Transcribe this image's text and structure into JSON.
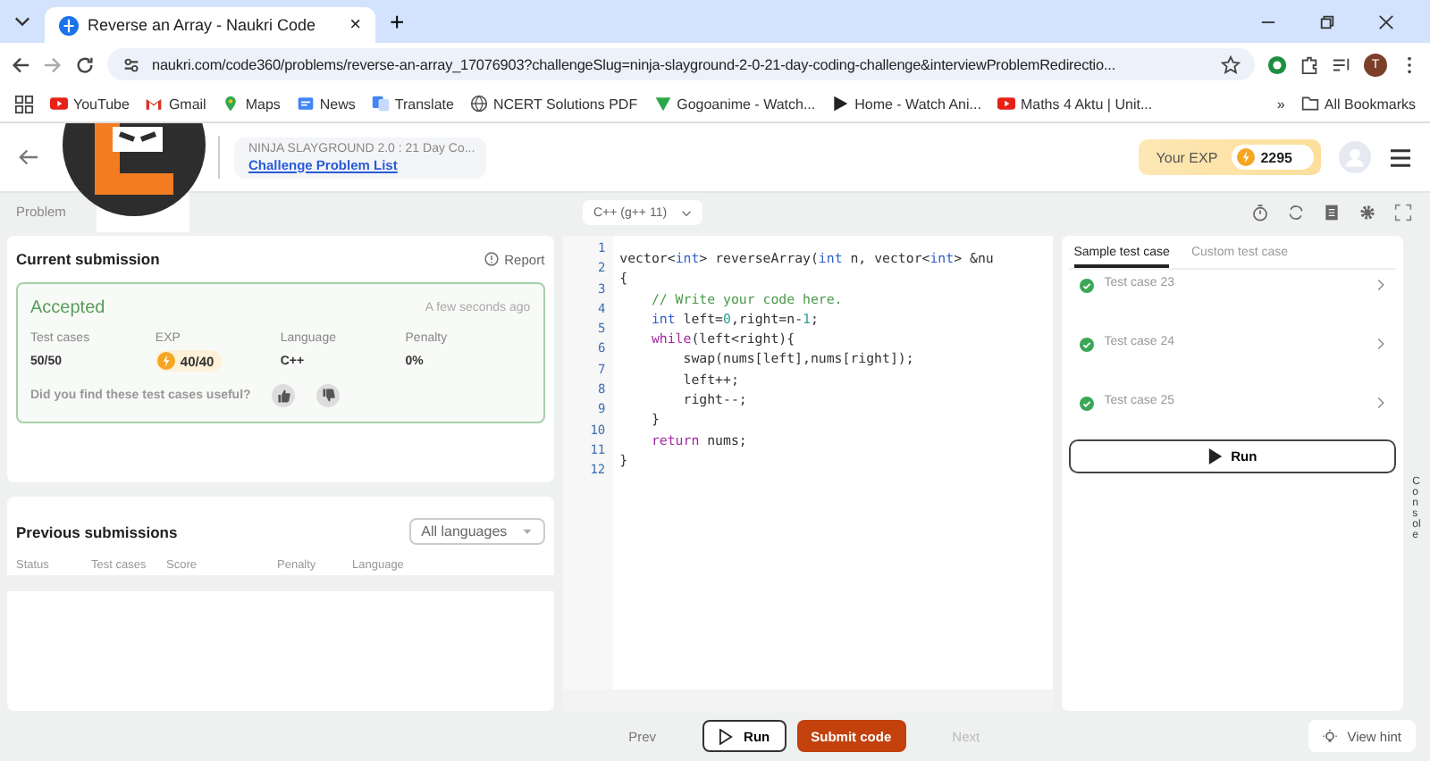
{
  "browser": {
    "tab_title": "Reverse an Array - Naukri Code",
    "tab_close": "×",
    "new_tab": "+",
    "url": "naukri.com/code360/problems/reverse-an-array_17076903?challengeSlug=ninja-slayground-2-0-21-day-coding-challenge&interviewProblemRedirectio...",
    "profile_initial": "T",
    "bookmarks": [
      {
        "label": "YouTube",
        "kind": "yt"
      },
      {
        "label": "Gmail",
        "kind": "mail"
      },
      {
        "label": "Maps",
        "kind": "pin"
      },
      {
        "label": "News",
        "kind": "news"
      },
      {
        "label": "Translate",
        "kind": "tr"
      },
      {
        "label": "NCERT Solutions PDF",
        "kind": "globe"
      },
      {
        "label": "Gogoanime - Watch...",
        "kind": "leaf"
      },
      {
        "label": "Home - Watch Ani...",
        "kind": "play"
      },
      {
        "label": "Maths 4 Aktu | Unit...",
        "kind": "yt"
      }
    ],
    "more_bookmarks": "»",
    "all_bookmarks": "All Bookmarks"
  },
  "header": {
    "challenge": "NINJA SLAYGROUND 2.0 : 21 Day Co...",
    "link": "Challenge Problem List",
    "exp_label": "Your EXP",
    "exp_value": "2295"
  },
  "tabs": [
    {
      "label": "Problem",
      "selected": false
    }
  ],
  "language_select": "C++ (g++ 11)",
  "current_submission": {
    "title": "Current submission",
    "report": "Report",
    "status": "Accepted",
    "time": "A few seconds ago",
    "stats": [
      {
        "label": "Test cases",
        "value": "50/50",
        "kind": "plain"
      },
      {
        "label": "EXP",
        "value": "40/40",
        "kind": "exp"
      },
      {
        "label": "Language",
        "value": "C++",
        "kind": "plain"
      },
      {
        "label": "Penalty",
        "value": "0%",
        "kind": "plain"
      }
    ],
    "feedback": "Did you find these test cases useful?"
  },
  "previous_submissions": {
    "title": "Previous submissions",
    "filter": "All languages",
    "columns": [
      "Status",
      "Test cases",
      "Score",
      "Penalty",
      "Language"
    ]
  },
  "code": [
    [
      {
        "t": "vector<",
        "kind": "plain"
      },
      {
        "t": "int",
        "kind": "type"
      },
      {
        "t": "> reverseArray(",
        "kind": "plain"
      },
      {
        "t": "int",
        "kind": "type"
      },
      {
        "t": " n, vector<",
        "kind": "plain"
      },
      {
        "t": "int",
        "kind": "type"
      },
      {
        "t": "> &nu",
        "kind": "plain"
      }
    ],
    [
      {
        "t": "{",
        "kind": "plain"
      }
    ],
    [
      {
        "t": "    // Write your code here.",
        "kind": "comment"
      }
    ],
    [
      {
        "t": "    int",
        "kind": "type"
      },
      {
        "t": " left=",
        "kind": "plain"
      },
      {
        "t": "0",
        "kind": "num"
      },
      {
        "t": ",right=n-",
        "kind": "plain"
      },
      {
        "t": "1",
        "kind": "num"
      },
      {
        "t": ";",
        "kind": "plain"
      }
    ],
    [
      {
        "t": "    while",
        "kind": "ctl"
      },
      {
        "t": "(left<right){",
        "kind": "plain"
      }
    ],
    [
      {
        "t": "        swap(nums[left],nums[right]);",
        "kind": "plain"
      }
    ],
    [
      {
        "t": "        left++;",
        "kind": "plain"
      }
    ],
    [
      {
        "t": "        right--;",
        "kind": "plain"
      }
    ],
    [
      {
        "t": "    }",
        "kind": "plain"
      }
    ],
    [
      {
        "t": "    return",
        "kind": "ctl"
      },
      {
        "t": " nums;",
        "kind": "plain"
      }
    ],
    [
      {
        "t": "}",
        "kind": "plain"
      }
    ]
  ],
  "line_numbers": [
    "1",
    "2",
    "3",
    "4",
    "5",
    "6",
    "7",
    "8",
    "9",
    "10",
    "11",
    "12"
  ],
  "test_tabs": [
    {
      "label": "Sample test case",
      "selected": true
    },
    {
      "label": "Custom test case",
      "selected": false
    }
  ],
  "test_cases": [
    {
      "label": "Test case 23",
      "passed": true
    },
    {
      "label": "Test case 24",
      "passed": true
    },
    {
      "label": "Test case 25",
      "passed": true
    }
  ],
  "run_tests": "Run",
  "console": "Console",
  "footer": {
    "prev": "Prev",
    "run": "Run",
    "submit": "Submit code",
    "next": "Next",
    "hint": "View hint"
  }
}
